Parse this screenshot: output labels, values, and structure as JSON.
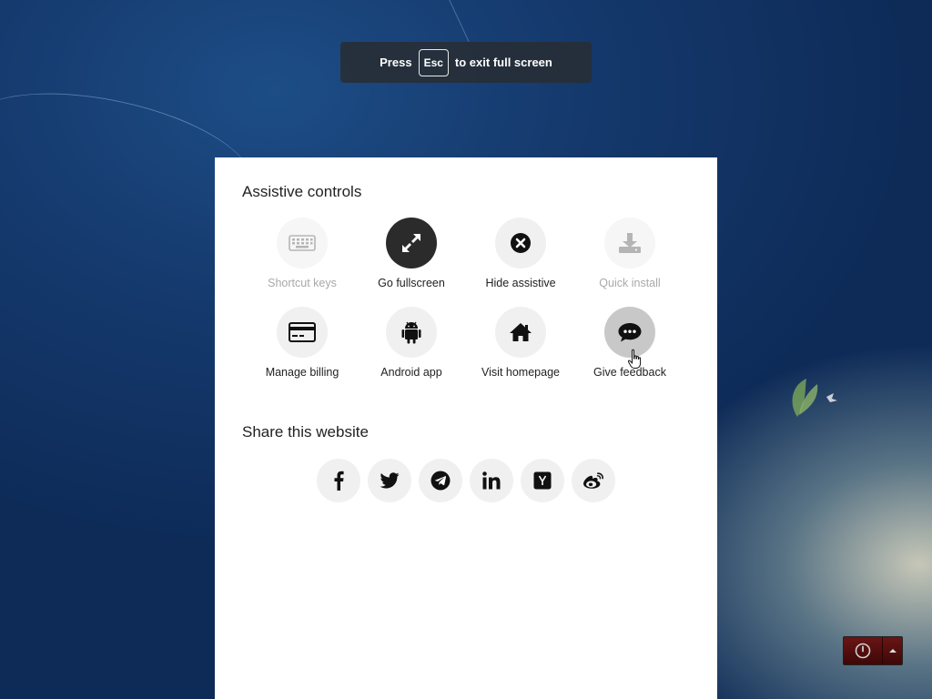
{
  "fullscreen_hint": {
    "prefix": "Press",
    "key": "Esc",
    "suffix": "to exit full screen"
  },
  "assistive": {
    "title": "Assistive controls",
    "controls": [
      {
        "label": "Shortcut keys",
        "icon": "keyboard-icon",
        "state": "disabled"
      },
      {
        "label": "Go fullscreen",
        "icon": "expand-icon",
        "state": "active"
      },
      {
        "label": "Hide assistive",
        "icon": "close-circle-icon",
        "state": "normal"
      },
      {
        "label": "Quick install",
        "icon": "download-icon",
        "state": "disabled"
      },
      {
        "label": "Manage billing",
        "icon": "credit-card-icon",
        "state": "normal"
      },
      {
        "label": "Android app",
        "icon": "android-icon",
        "state": "normal"
      },
      {
        "label": "Visit homepage",
        "icon": "home-icon",
        "state": "normal"
      },
      {
        "label": "Give feedback",
        "icon": "chat-bubble-icon",
        "state": "hover"
      }
    ]
  },
  "share": {
    "title": "Share this website",
    "networks": [
      "facebook-icon",
      "twitter-icon",
      "telegram-icon",
      "linkedin-icon",
      "hacker-news-icon",
      "weibo-icon"
    ]
  },
  "tray": {
    "power_icon": "power-icon",
    "arrow_icon": "up-arrow-icon"
  }
}
